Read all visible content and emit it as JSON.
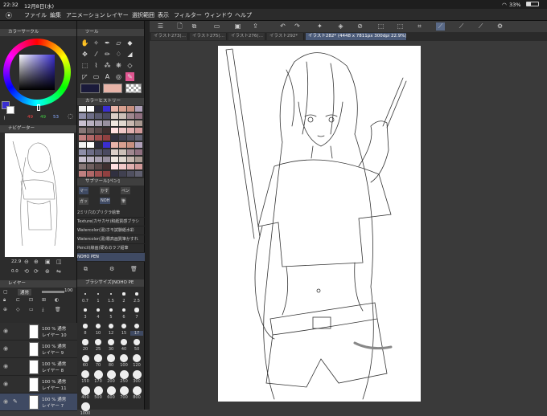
{
  "status_bar": {
    "time": "22:32",
    "date": "12月8日(水)",
    "battery": "33%"
  },
  "menu": [
    "ファイル",
    "編集",
    "アニメーション",
    "レイヤー",
    "選択範囲",
    "表示",
    "フィルター",
    "ウィンドウ",
    "ヘルプ"
  ],
  "tabs": [
    "イラスト273(…",
    "イラスト275(…",
    "イラスト276(…",
    "イラスト292*",
    "イラスト282* (4448 x 7811px 300dpi 22.9%)"
  ],
  "panels": {
    "color_circle": "カラーサークル",
    "tool": "ツール",
    "color_history": "カラーヒストリー",
    "navigator": "ナビゲーター",
    "sub_tool": "サブツール[ペン]",
    "layer": "レイヤー",
    "brush_size": "ブラシサイズ[NOHO PE"
  },
  "color_values": {
    "h": "49",
    "s": "49",
    "v": "53"
  },
  "navigator": {
    "zoom": "22.9",
    "rotate": "0.0"
  },
  "sub_tool_tabs": [
    "マー",
    "かす",
    "ペン",
    "ガッ",
    "NOH",
    "筆"
  ],
  "brush_list": [
    "2ミリ穴のプリクラ絵筆",
    "Texture(カサカサ)和紙質感ブラシ",
    "Watercolor(湯)ホモ試験紙水彩",
    "Watercolor(湯)霧高画質筆かすれ",
    "Pencil(線画)硬めのラフ鉛筆",
    "NOHO PEN"
  ],
  "layer_blend": "通常",
  "layer_opacity": "100",
  "layers": [
    {
      "opacity": "100 %  通常",
      "name": "レイヤー 10"
    },
    {
      "opacity": "100 %  通常",
      "name": "レイヤー 9"
    },
    {
      "opacity": "100 %  通常",
      "name": "レイヤー 8"
    },
    {
      "opacity": "100 %  通常",
      "name": "レイヤー 11"
    },
    {
      "opacity": "100 %  通常",
      "name": "レイヤー 7"
    }
  ],
  "brush_sizes": [
    "0.7",
    "1",
    "1.5",
    "2",
    "2.5",
    "3",
    "4",
    "5",
    "6",
    "7",
    "8",
    "10",
    "12",
    "15",
    "17",
    "20",
    "25",
    "30",
    "40",
    "50",
    "60",
    "70",
    "80",
    "100",
    "120",
    "150",
    "170",
    "200",
    "250",
    "300",
    "400",
    "500",
    "600",
    "700",
    "800",
    "1000"
  ],
  "colors": {
    "accent": "#4a5a78",
    "selected_color": "#3a2ed0",
    "panel": "#2c2c2c"
  }
}
